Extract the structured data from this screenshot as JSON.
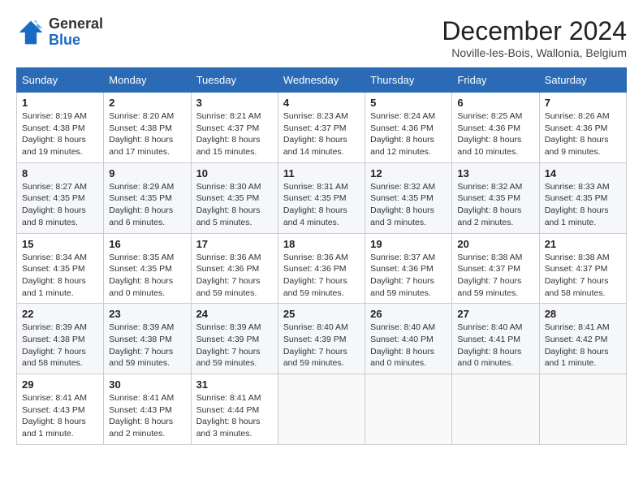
{
  "header": {
    "logo_general": "General",
    "logo_blue": "Blue",
    "month_title": "December 2024",
    "subtitle": "Noville-les-Bois, Wallonia, Belgium"
  },
  "days_of_week": [
    "Sunday",
    "Monday",
    "Tuesday",
    "Wednesday",
    "Thursday",
    "Friday",
    "Saturday"
  ],
  "weeks": [
    [
      {
        "day": "1",
        "sunrise": "8:19 AM",
        "sunset": "4:38 PM",
        "daylight": "8 hours and 19 minutes."
      },
      {
        "day": "2",
        "sunrise": "8:20 AM",
        "sunset": "4:38 PM",
        "daylight": "8 hours and 17 minutes."
      },
      {
        "day": "3",
        "sunrise": "8:21 AM",
        "sunset": "4:37 PM",
        "daylight": "8 hours and 15 minutes."
      },
      {
        "day": "4",
        "sunrise": "8:23 AM",
        "sunset": "4:37 PM",
        "daylight": "8 hours and 14 minutes."
      },
      {
        "day": "5",
        "sunrise": "8:24 AM",
        "sunset": "4:36 PM",
        "daylight": "8 hours and 12 minutes."
      },
      {
        "day": "6",
        "sunrise": "8:25 AM",
        "sunset": "4:36 PM",
        "daylight": "8 hours and 10 minutes."
      },
      {
        "day": "7",
        "sunrise": "8:26 AM",
        "sunset": "4:36 PM",
        "daylight": "8 hours and 9 minutes."
      }
    ],
    [
      {
        "day": "8",
        "sunrise": "8:27 AM",
        "sunset": "4:35 PM",
        "daylight": "8 hours and 8 minutes."
      },
      {
        "day": "9",
        "sunrise": "8:29 AM",
        "sunset": "4:35 PM",
        "daylight": "8 hours and 6 minutes."
      },
      {
        "day": "10",
        "sunrise": "8:30 AM",
        "sunset": "4:35 PM",
        "daylight": "8 hours and 5 minutes."
      },
      {
        "day": "11",
        "sunrise": "8:31 AM",
        "sunset": "4:35 PM",
        "daylight": "8 hours and 4 minutes."
      },
      {
        "day": "12",
        "sunrise": "8:32 AM",
        "sunset": "4:35 PM",
        "daylight": "8 hours and 3 minutes."
      },
      {
        "day": "13",
        "sunrise": "8:32 AM",
        "sunset": "4:35 PM",
        "daylight": "8 hours and 2 minutes."
      },
      {
        "day": "14",
        "sunrise": "8:33 AM",
        "sunset": "4:35 PM",
        "daylight": "8 hours and 1 minute."
      }
    ],
    [
      {
        "day": "15",
        "sunrise": "8:34 AM",
        "sunset": "4:35 PM",
        "daylight": "8 hours and 1 minute."
      },
      {
        "day": "16",
        "sunrise": "8:35 AM",
        "sunset": "4:35 PM",
        "daylight": "8 hours and 0 minutes."
      },
      {
        "day": "17",
        "sunrise": "8:36 AM",
        "sunset": "4:36 PM",
        "daylight": "7 hours and 59 minutes."
      },
      {
        "day": "18",
        "sunrise": "8:36 AM",
        "sunset": "4:36 PM",
        "daylight": "7 hours and 59 minutes."
      },
      {
        "day": "19",
        "sunrise": "8:37 AM",
        "sunset": "4:36 PM",
        "daylight": "7 hours and 59 minutes."
      },
      {
        "day": "20",
        "sunrise": "8:38 AM",
        "sunset": "4:37 PM",
        "daylight": "7 hours and 59 minutes."
      },
      {
        "day": "21",
        "sunrise": "8:38 AM",
        "sunset": "4:37 PM",
        "daylight": "7 hours and 58 minutes."
      }
    ],
    [
      {
        "day": "22",
        "sunrise": "8:39 AM",
        "sunset": "4:38 PM",
        "daylight": "7 hours and 58 minutes."
      },
      {
        "day": "23",
        "sunrise": "8:39 AM",
        "sunset": "4:38 PM",
        "daylight": "7 hours and 59 minutes."
      },
      {
        "day": "24",
        "sunrise": "8:39 AM",
        "sunset": "4:39 PM",
        "daylight": "7 hours and 59 minutes."
      },
      {
        "day": "25",
        "sunrise": "8:40 AM",
        "sunset": "4:39 PM",
        "daylight": "7 hours and 59 minutes."
      },
      {
        "day": "26",
        "sunrise": "8:40 AM",
        "sunset": "4:40 PM",
        "daylight": "8 hours and 0 minutes."
      },
      {
        "day": "27",
        "sunrise": "8:40 AM",
        "sunset": "4:41 PM",
        "daylight": "8 hours and 0 minutes."
      },
      {
        "day": "28",
        "sunrise": "8:41 AM",
        "sunset": "4:42 PM",
        "daylight": "8 hours and 1 minute."
      }
    ],
    [
      {
        "day": "29",
        "sunrise": "8:41 AM",
        "sunset": "4:43 PM",
        "daylight": "8 hours and 1 minute."
      },
      {
        "day": "30",
        "sunrise": "8:41 AM",
        "sunset": "4:43 PM",
        "daylight": "8 hours and 2 minutes."
      },
      {
        "day": "31",
        "sunrise": "8:41 AM",
        "sunset": "4:44 PM",
        "daylight": "8 hours and 3 minutes."
      },
      null,
      null,
      null,
      null
    ]
  ]
}
